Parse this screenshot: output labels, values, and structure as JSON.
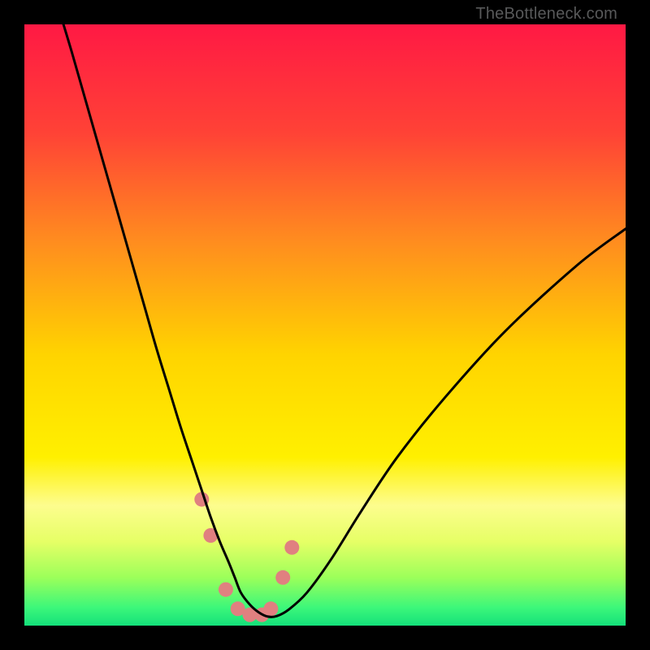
{
  "watermark": "TheBottleneck.com",
  "chart_data": {
    "type": "line",
    "title": "",
    "xlabel": "",
    "ylabel": "",
    "xlim": [
      0,
      100
    ],
    "ylim": [
      0,
      100
    ],
    "grid": false,
    "legend": false,
    "axes_visible": false,
    "background_gradient": {
      "type": "vertical",
      "stops": [
        {
          "pos": 0.0,
          "color": "#ff1944"
        },
        {
          "pos": 0.18,
          "color": "#ff4236"
        },
        {
          "pos": 0.36,
          "color": "#ff8c1f"
        },
        {
          "pos": 0.55,
          "color": "#ffd400"
        },
        {
          "pos": 0.72,
          "color": "#fff000"
        },
        {
          "pos": 0.8,
          "color": "#fdfd8e"
        },
        {
          "pos": 0.86,
          "color": "#e6ff66"
        },
        {
          "pos": 0.92,
          "color": "#9cff5a"
        },
        {
          "pos": 0.97,
          "color": "#3cf77a"
        },
        {
          "pos": 1.0,
          "color": "#14e07a"
        }
      ]
    },
    "series": [
      {
        "name": "bottleneck-curve",
        "color": "#000000",
        "x": [
          6.5,
          8,
          10,
          12,
          14,
          16,
          18,
          20,
          22,
          24,
          26,
          28,
          29.5,
          31,
          32.5,
          34,
          35,
          36,
          37.5,
          39,
          40.5,
          42,
          44,
          47,
          51,
          56,
          62,
          70,
          80,
          92,
          100
        ],
        "y": [
          100,
          95,
          88,
          81,
          74,
          67,
          60,
          53,
          46,
          39.5,
          33,
          27,
          22.5,
          18,
          14,
          10.5,
          8,
          5.5,
          3.5,
          2.2,
          1.5,
          1.6,
          2.7,
          5.5,
          11,
          19,
          28,
          38,
          49,
          60,
          66
        ]
      }
    ],
    "markers": {
      "name": "highlighted-points",
      "color": "#e08080",
      "radius": 9,
      "x": [
        29.5,
        31.0,
        33.5,
        35.5,
        37.5,
        39.5,
        41.0,
        43.0,
        44.5
      ],
      "y": [
        21.0,
        15.0,
        6.0,
        2.8,
        1.8,
        1.8,
        2.8,
        8.0,
        13.0
      ]
    }
  }
}
